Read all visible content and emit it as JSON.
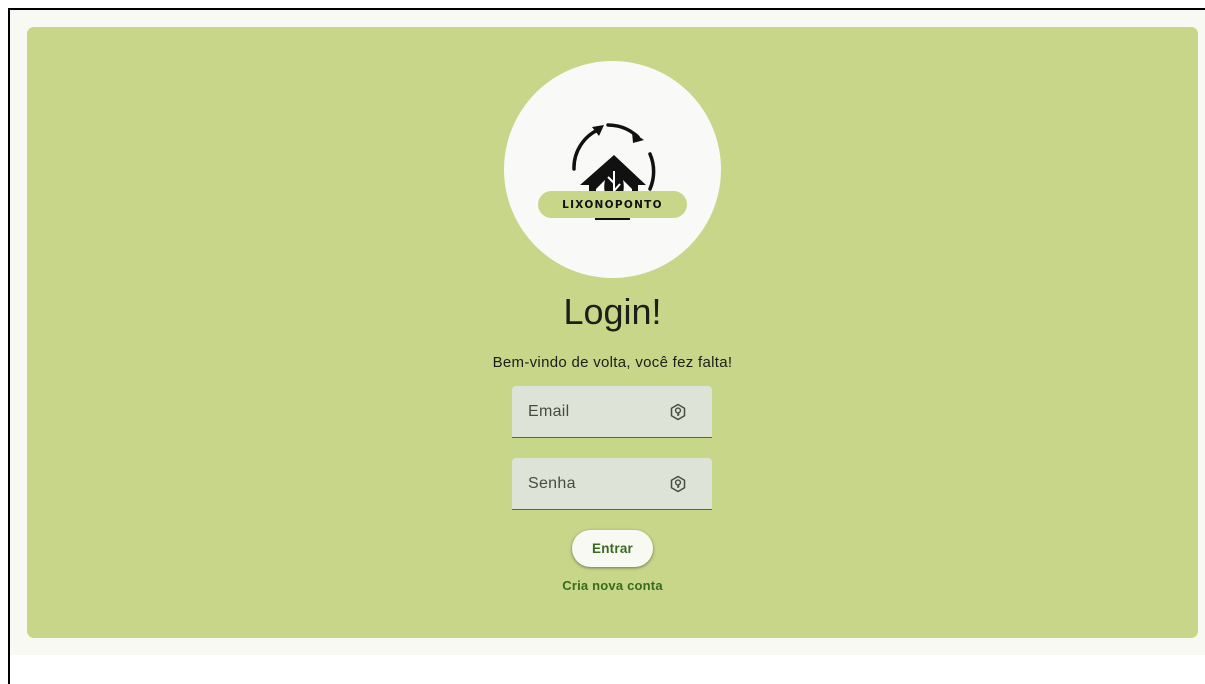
{
  "colors": {
    "card_background": "#c7d689",
    "logo_pill": "#c7d689",
    "accent": "#386a20",
    "field_background": "#dde3d6"
  },
  "logo": {
    "brand_text": "LIXONOPONTO",
    "icon": "recycle-house-leaf-logo"
  },
  "login": {
    "title": "Login!",
    "subtitle": "Bem-vindo de volta, você fez falta!",
    "email": {
      "placeholder": "Email",
      "value": "",
      "icon": "key-shield-icon"
    },
    "password": {
      "placeholder": "Senha",
      "value": "",
      "icon": "key-shield-icon"
    },
    "submit_label": "Entrar",
    "create_account_label": "Cria nova conta"
  }
}
